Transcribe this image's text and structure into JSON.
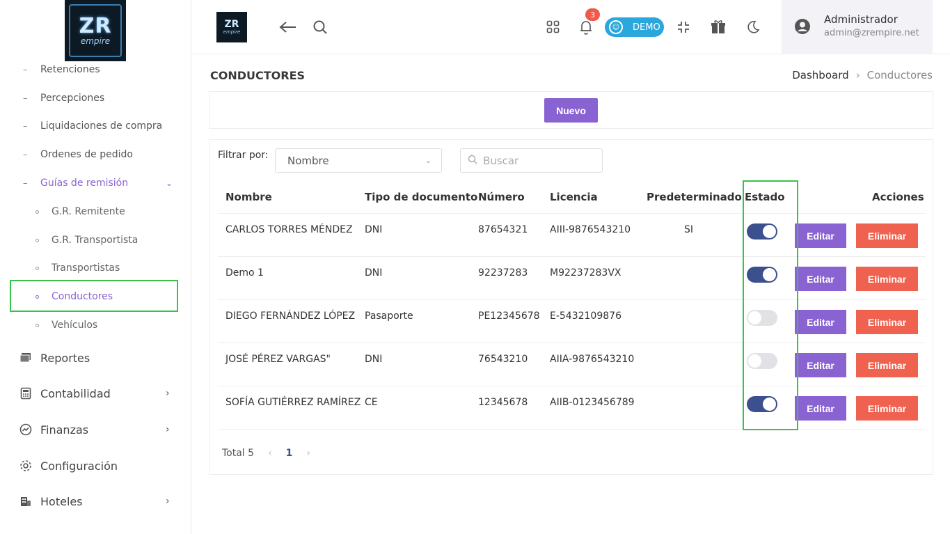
{
  "logo": {
    "top": "ZR",
    "bottom": "empire"
  },
  "sidebar": {
    "subitems": [
      {
        "label": "Retenciones"
      },
      {
        "label": "Percepciones"
      },
      {
        "label": "Liquidaciones de compra"
      },
      {
        "label": "Ordenes de pedido"
      },
      {
        "label": "Guías de remisión"
      }
    ],
    "children": [
      {
        "label": "G.R. Remitente"
      },
      {
        "label": "G.R. Transportista"
      },
      {
        "label": "Transportistas"
      },
      {
        "label": "Conductores"
      },
      {
        "label": "Vehículos"
      }
    ],
    "main": [
      {
        "label": "Reportes"
      },
      {
        "label": "Contabilidad"
      },
      {
        "label": "Finanzas"
      },
      {
        "label": "Configuración"
      },
      {
        "label": "Hoteles"
      }
    ]
  },
  "topbar": {
    "notification_count": "3",
    "demo_label": "DEMO",
    "user_name": "Administrador",
    "user_email": "admin@zrempire.net"
  },
  "page": {
    "title": "CONDUCTORES",
    "breadcrumb": [
      "Dashboard",
      "Conductores"
    ],
    "new_button": "Nuevo"
  },
  "filter": {
    "label": "Filtrar por:",
    "selected": "Nombre",
    "search_placeholder": "Buscar"
  },
  "table": {
    "headers": [
      "Nombre",
      "Tipo de documento",
      "Número",
      "Licencia",
      "Predeterminado",
      "Estado",
      "Acciones"
    ],
    "rows": [
      {
        "nombre": "CARLOS TORRES MÉNDEZ",
        "tipo": "DNI",
        "numero": "87654321",
        "licencia": "AIII-9876543210",
        "predeterminado": "SI",
        "estado": true
      },
      {
        "nombre": "Demo 1",
        "tipo": "DNI",
        "numero": "92237283",
        "licencia": "M92237283VX",
        "predeterminado": "",
        "estado": true
      },
      {
        "nombre": "DIEGO FERNÁNDEZ LÓPEZ",
        "tipo": "Pasaporte",
        "numero": "PE12345678",
        "licencia": "E-5432109876",
        "predeterminado": "",
        "estado": false
      },
      {
        "nombre": "JOSÉ PÉREZ VARGAS\"",
        "tipo": "DNI",
        "numero": "76543210",
        "licencia": "AIIA-9876543210",
        "predeterminado": "",
        "estado": false
      },
      {
        "nombre": "SOFÍA GUTIÉRREZ RAMÍREZ",
        "tipo": "CE",
        "numero": "12345678",
        "licencia": "AIIB-0123456789",
        "predeterminado": "",
        "estado": true
      }
    ],
    "edit_label": "Editar",
    "delete_label": "Eliminar"
  },
  "pagination": {
    "total": "Total 5",
    "current": "1"
  }
}
